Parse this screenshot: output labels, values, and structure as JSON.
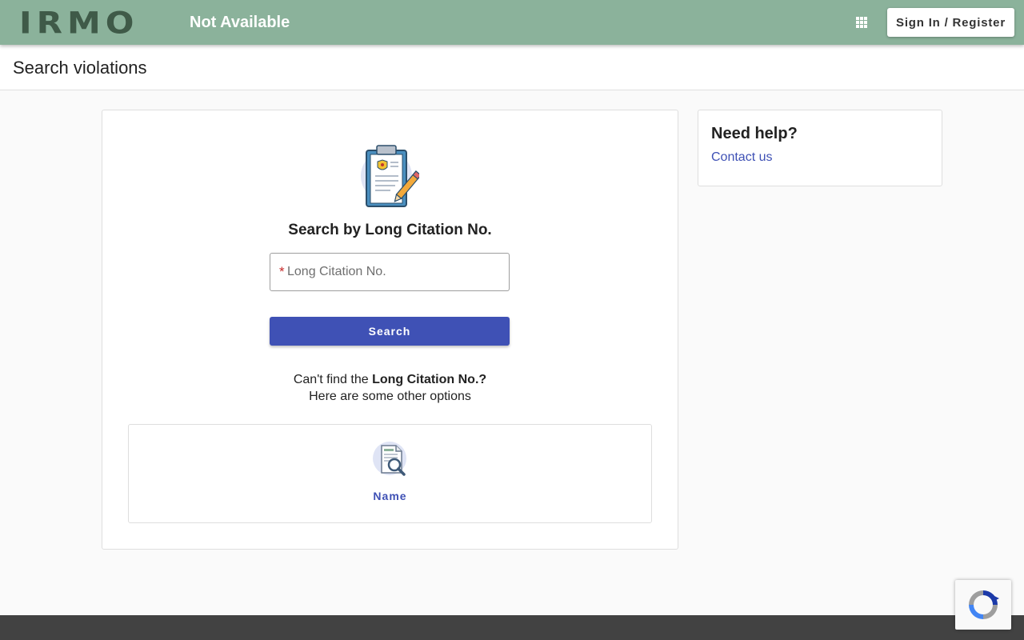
{
  "header": {
    "logo_text": "IRMO",
    "status_text": "Not Available",
    "apps_icon": "grid-apps-icon",
    "signin_label": "Sign In / Register"
  },
  "page": {
    "title": "Search violations"
  },
  "search": {
    "heading": "Search by Long Citation No.",
    "required_marker": "*",
    "placeholder": "Long Citation No.",
    "value": "",
    "button_label": "Search",
    "help_prefix": "Can't find the ",
    "help_bold": "Long Citation No.?",
    "help_line2": "Here are some other options",
    "clipboard_icon": "clipboard-badge-icon"
  },
  "options": [
    {
      "label": "Name",
      "icon": "document-search-icon"
    }
  ],
  "help": {
    "title": "Need help?",
    "contact_label": "Contact us"
  },
  "colors": {
    "header_bg": "#8bb29b",
    "logo": "#3f5a48",
    "primary": "#3f51b5",
    "footer": "#424242",
    "required": "#c62828"
  }
}
